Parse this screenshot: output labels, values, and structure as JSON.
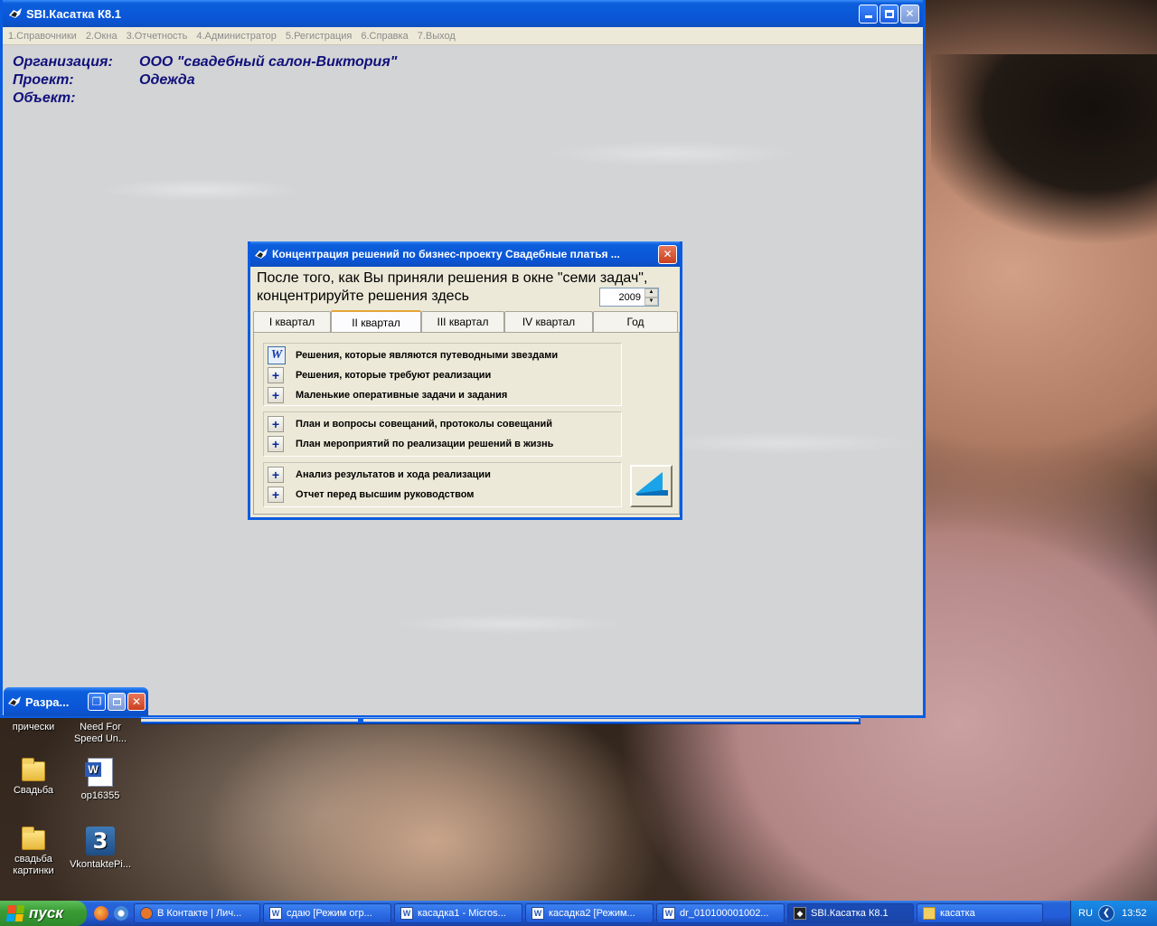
{
  "desktop": {
    "icons": [
      {
        "label": "прически"
      },
      {
        "label": "Need For Speed Un..."
      },
      {
        "label": "Свадьба"
      },
      {
        "label": "op16355"
      },
      {
        "label": "свадьба картинки"
      },
      {
        "label": "VkontaktePi..."
      }
    ]
  },
  "main_window": {
    "title": "SBI.Касатка К8.1",
    "menu": [
      "1.Справочники",
      "2.Окна",
      "3.Отчетность",
      "4.Администратор",
      "5.Регистрация",
      "6.Справка",
      "7.Выход"
    ],
    "info": {
      "org_label": "Организация:",
      "org_value": "ООО \"свадебный салон-Виктория\"",
      "project_label": "Проект:",
      "project_value": "Одежда",
      "object_label": "Объект:",
      "object_value": ""
    }
  },
  "dialog": {
    "title": "Концентрация решений по бизнес-проекту Свадебные платья   ...",
    "heading_line1": "После того, как Вы приняли решения в окне \"семи задач\",",
    "heading_line2": "концентрируйте решения здесь",
    "year": "2009",
    "tabs": [
      "I квартал",
      "II квартал",
      "III квартал",
      "IV квартал",
      "Год"
    ],
    "active_tab": "II квартал",
    "groups": [
      [
        "Решения, которые являются путеводными звездами",
        "Решения, которые требуют реализации",
        "Маленькие оперативные задачи и задания"
      ],
      [
        "План и вопросы совещаний, протоколы совещаний",
        "План мероприятий по реализации решений в жизнь"
      ],
      [
        "Анализ результатов и хода реализации",
        "Отчет перед высшим руководством"
      ]
    ]
  },
  "minimized_window": {
    "title": "Разра..."
  },
  "taskbar": {
    "start_label": "пуск",
    "tasks": [
      "В Контакте | Лич...",
      "сдаю [Режим огр...",
      "касадка1 - Micros...",
      "касадка2 [Режим...",
      "dr_010100001002...",
      "SBI.Касатка К8.1",
      "касатка"
    ],
    "lang": "RU",
    "clock": "13:52"
  },
  "colors": {
    "xp_blue": "#0a5ce0",
    "info_text": "#10107a",
    "dialog_bg": "#ece9d8"
  }
}
